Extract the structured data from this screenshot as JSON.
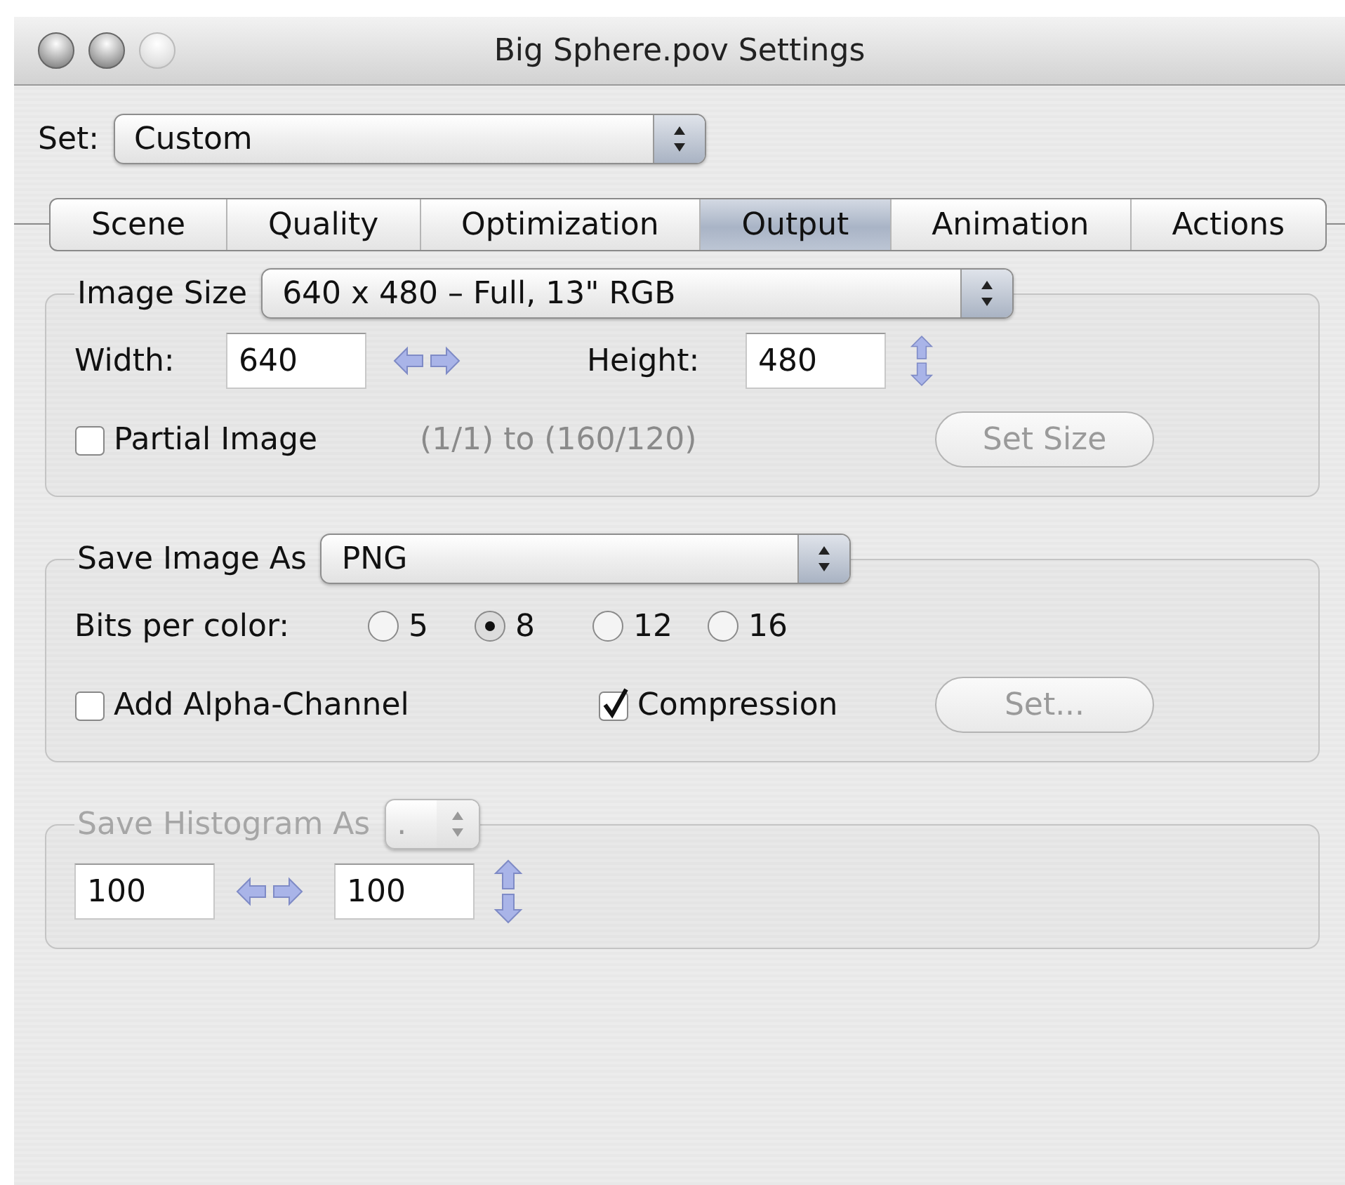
{
  "window": {
    "title": "Big Sphere.pov Settings",
    "buttons": [
      {
        "disabled": false
      },
      {
        "disabled": false
      },
      {
        "disabled": true
      }
    ]
  },
  "set": {
    "label": "Set:",
    "value": "Custom"
  },
  "tabs": [
    {
      "label": "Scene",
      "selected": false
    },
    {
      "label": "Quality",
      "selected": false
    },
    {
      "label": "Optimization",
      "selected": false
    },
    {
      "label": "Output",
      "selected": true
    },
    {
      "label": "Animation",
      "selected": false
    },
    {
      "label": "Actions",
      "selected": false
    }
  ],
  "groups": [
    {
      "title": "Image Size",
      "popup": "640 x 480 – Full, 13\" RGB",
      "disabled": false,
      "controls": [
        {
          "kind": "label",
          "text": "Width:"
        },
        {
          "kind": "field",
          "value": "640"
        },
        {
          "kind": "hstepper"
        },
        {
          "kind": "label",
          "text": "Height:"
        },
        {
          "kind": "field",
          "value": "480"
        },
        {
          "kind": "vstepper"
        },
        {
          "kind": "checkbox",
          "label": "Partial Image",
          "checked": false
        },
        {
          "kind": "note",
          "text": "(1/1) to (160/120)"
        },
        {
          "kind": "button",
          "label": "Set Size",
          "disabled": true
        }
      ]
    },
    {
      "title": "Save Image As",
      "popup": "PNG",
      "disabled": false,
      "controls": [
        {
          "kind": "label",
          "text": "Bits per color:"
        },
        {
          "kind": "radio",
          "label": "5",
          "selected": false
        },
        {
          "kind": "radio",
          "label": "8",
          "selected": true
        },
        {
          "kind": "radio",
          "label": "12",
          "selected": false
        },
        {
          "kind": "radio",
          "label": "16",
          "selected": false
        },
        {
          "kind": "checkbox",
          "label": "Add Alpha-Channel",
          "checked": false
        },
        {
          "kind": "checkbox",
          "label": "Compression",
          "checked": true
        },
        {
          "kind": "button",
          "label": "Set...",
          "disabled": true
        }
      ]
    },
    {
      "title": "Save Histogram As",
      "popup": ".",
      "disabled": true,
      "controls": [
        {
          "kind": "field",
          "value": "100"
        },
        {
          "kind": "hstepper"
        },
        {
          "kind": "field",
          "value": "100"
        },
        {
          "kind": "vstepper"
        }
      ]
    }
  ]
}
